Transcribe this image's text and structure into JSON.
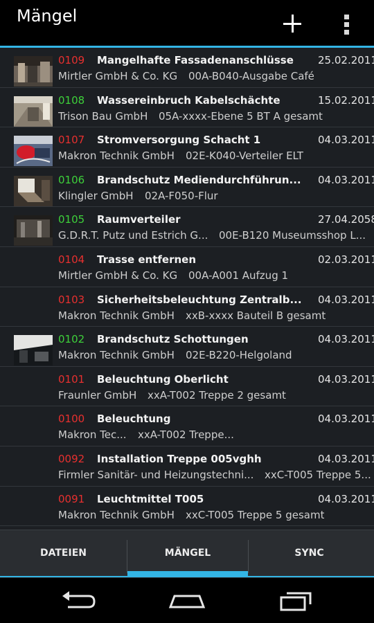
{
  "actionbar": {
    "title": "Mängel",
    "add_icon": "plus-icon",
    "overflow_icon": "overflow-menu-icon",
    "accent": "#33b5e5"
  },
  "colors": {
    "red": "#e8302f",
    "green": "#3ed13a",
    "accent": "#33b5e5"
  },
  "maengel": [
    {
      "number": "0109",
      "status": "red",
      "title": "Mangelhafte Fassadenanschlüsse",
      "date": "25.02.2011",
      "company": "Mirtler GmbH & Co. KG",
      "location": "00A-B040-Ausgabe Café",
      "thumbnail": "facade-photo"
    },
    {
      "number": "0108",
      "status": "green",
      "title": "Wassereinbruch Kabelschächte",
      "date": "15.02.2011",
      "company": "Trison Bau GmbH",
      "location": "05A-xxxx-Ebene 5 BT A gesamt",
      "thumbnail": "corridor-photo"
    },
    {
      "number": "0107",
      "status": "red",
      "title": "Stromversorgung Schacht 1",
      "date": "04.03.2011",
      "company": "Makron Technik GmbH",
      "location": "02E-K040-Verteiler ELT",
      "thumbnail": "cables-photo"
    },
    {
      "number": "0106",
      "status": "green",
      "title": "Brandschutz Mediendurchführun...",
      "date": "04.03.2011",
      "company": "Klingler GmbH",
      "location": "02A-F050-Flur",
      "thumbnail": "fire-protection-photo"
    },
    {
      "number": "0105",
      "status": "green",
      "title": "Raumverteiler",
      "date": "27.04.2058",
      "company": "G.D.R.T. Putz und Estrich G...",
      "location": "00E-B120 Museumsshop L...",
      "thumbnail": "room-photo"
    },
    {
      "number": "0104",
      "status": "red",
      "title": "Trasse entfernen",
      "date": "02.03.2011",
      "company": "Mirtler GmbH & Co. KG",
      "location": "00A-A001 Aufzug 1",
      "thumbnail": ""
    },
    {
      "number": "0103",
      "status": "red",
      "title": "Sicherheitsbeleuchtung Zentralb...",
      "date": "04.03.2011",
      "company": "Makron Technik GmbH",
      "location": "xxB-xxxx Bauteil B gesamt",
      "thumbnail": ""
    },
    {
      "number": "0102",
      "status": "green",
      "title": "Brandschutz Schottungen",
      "date": "04.03.2011",
      "company": "Makron Technik GmbH",
      "location": "02E-B220-Helgoland",
      "thumbnail": "ceiling-photo"
    },
    {
      "number": "0101",
      "status": "red",
      "title": "Beleuchtung Oberlicht",
      "date": "04.03.2011",
      "company": "Fraunler GmbH",
      "location": "xxA-T002 Treppe 2 gesamt",
      "thumbnail": ""
    },
    {
      "number": "0100",
      "status": "red",
      "title": "Beleuchtung",
      "date": "04.03.2011",
      "company": "Makron Tec...",
      "location": "xxA-T002 Treppe...",
      "thumbnail": ""
    },
    {
      "number": "0092",
      "status": "red",
      "title": "Installation Treppe 005vghh",
      "date": "04.03.2011",
      "company": "Firmler Sanitär- und Heizungstechni...",
      "location": "xxC-T005 Treppe 5...",
      "thumbnail": ""
    },
    {
      "number": "0091",
      "status": "red",
      "title": "Leuchtmittel T005",
      "date": "04.03.2011",
      "company": "Makron Technik GmbH",
      "location": "xxC-T005 Treppe 5 gesamt",
      "thumbnail": ""
    }
  ],
  "tabs": [
    {
      "label": "DATEIEN",
      "selected": false
    },
    {
      "label": "MÄNGEL",
      "selected": true
    },
    {
      "label": "SYNC",
      "selected": false
    }
  ],
  "navbar": {
    "back_icon": "back-icon",
    "home_icon": "home-icon",
    "recents_icon": "recent-apps-icon"
  }
}
